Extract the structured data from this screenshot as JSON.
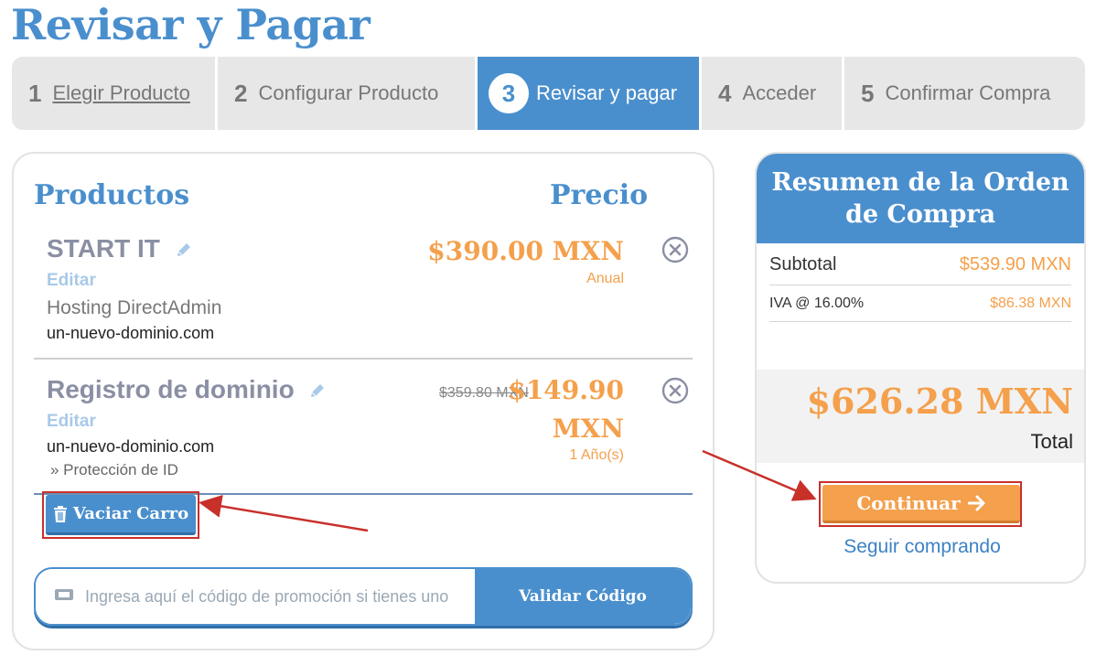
{
  "page_title": "Revisar y Pagar",
  "steps": [
    {
      "num": "1",
      "label": "Elegir Producto"
    },
    {
      "num": "2",
      "label": "Configurar Producto"
    },
    {
      "num": "3",
      "label": "Revisar y pagar"
    },
    {
      "num": "4",
      "label": "Acceder"
    },
    {
      "num": "5",
      "label": "Confirmar Compra"
    }
  ],
  "products": {
    "header_products": "Productos",
    "header_price": "Precio",
    "items": [
      {
        "name": "START IT",
        "edit": "Editar",
        "group": "Hosting DirectAdmin",
        "domain": "un-nuevo-dominio.com",
        "price": "$390.00 MXN",
        "billing": "Anual"
      },
      {
        "name": "Registro de dominio",
        "edit": "Editar",
        "domain": "un-nuevo-dominio.com",
        "addon": "» Protección de ID",
        "old_price": "$359.80 MXN",
        "price_line1": "$149.90",
        "price_line2": "MXN",
        "billing": "1 Año(s)"
      }
    ],
    "empty_cart": "Vaciar Carro",
    "promo_placeholder": "Ingresa aquí el código de promoción si tienes uno",
    "validate_code": "Validar Código"
  },
  "summary": {
    "title": "Resumen de la Orden de Compra",
    "subtotal_label": "Subtotal",
    "subtotal_value": "$539.90 MXN",
    "tax_label": "IVA @ 16.00%",
    "tax_value": "$86.38 MXN",
    "total_value": "$626.28 MXN",
    "total_label": "Total",
    "continue": "Continuar",
    "continue_shopping": "Seguir comprando"
  },
  "colors": {
    "brand_blue": "#4a8fcd",
    "price_orange": "#f4a04c",
    "highlight_red": "#c8302a"
  }
}
